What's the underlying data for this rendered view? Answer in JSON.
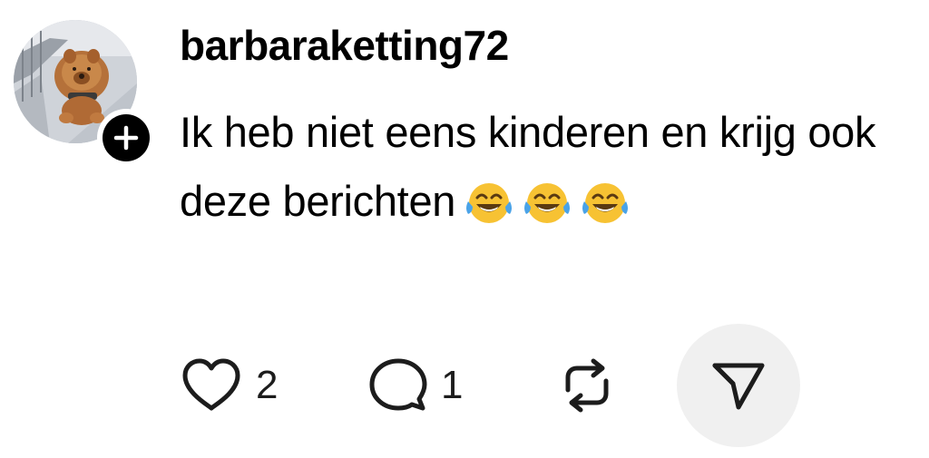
{
  "post": {
    "username": "barbaraketting72",
    "text": "Ik heb niet eens kinderen en krijg ook deze berichten",
    "emojis": [
      "😂",
      "😂",
      "😂"
    ],
    "avatar_icon": "dog-photo-avatar",
    "follow_icon": "plus-icon"
  },
  "actions": {
    "like_count": "2",
    "comment_count": "1"
  },
  "colors": {
    "text": "#000000",
    "icon": "#1c1c1c",
    "share_bg": "#f0f0f0",
    "emoji_face": "#f7c233"
  }
}
